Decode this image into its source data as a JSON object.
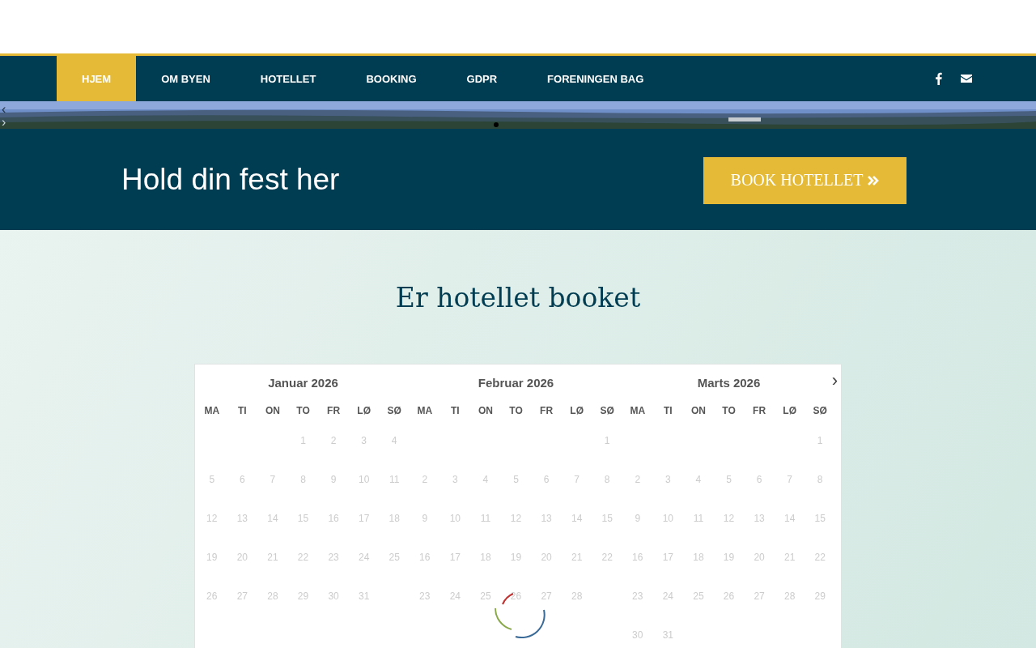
{
  "nav": {
    "items": [
      {
        "label": "HJEM",
        "selected": true
      },
      {
        "label": "OM BYEN",
        "selected": false
      },
      {
        "label": "HOTELLET",
        "selected": false
      },
      {
        "label": "BOOKING",
        "selected": false
      },
      {
        "label": "GDPR",
        "selected": false
      },
      {
        "label": "FORENINGEN BAG",
        "selected": false
      }
    ]
  },
  "slider": {
    "arrows": [
      "‹",
      "›"
    ]
  },
  "hero": {
    "headline": "Hold din fest her",
    "button": "BOOK HOTELLET"
  },
  "section": {
    "title": "Er hotellet booket"
  },
  "calendar": {
    "next": "›",
    "months": [
      {
        "title": "Januar 2026",
        "weekdays": [
          "MA",
          "TI",
          "ON",
          "TO",
          "FR",
          "LØ",
          "SØ"
        ],
        "weeks": [
          [
            {
              "kind": "blank"
            },
            {
              "kind": "blank"
            },
            {
              "kind": "blank"
            },
            {
              "kind": "day",
              "day": "1"
            },
            {
              "kind": "day",
              "day": "2"
            },
            {
              "kind": "day",
              "day": "3"
            },
            {
              "kind": "day",
              "day": "4"
            }
          ],
          [
            {
              "kind": "day",
              "day": "5"
            },
            {
              "kind": "day",
              "day": "6"
            },
            {
              "kind": "day",
              "day": "7"
            },
            {
              "kind": "day",
              "day": "8"
            },
            {
              "kind": "day",
              "day": "9"
            },
            {
              "kind": "day",
              "day": "10"
            },
            {
              "kind": "day",
              "day": "11"
            }
          ],
          [
            {
              "kind": "day",
              "day": "12"
            },
            {
              "kind": "day",
              "day": "13"
            },
            {
              "kind": "day",
              "day": "14"
            },
            {
              "kind": "day",
              "day": "15"
            },
            {
              "kind": "day",
              "day": "16"
            },
            {
              "kind": "day",
              "day": "17"
            },
            {
              "kind": "day",
              "day": "18"
            }
          ],
          [
            {
              "kind": "day",
              "day": "19"
            },
            {
              "kind": "day",
              "day": "20"
            },
            {
              "kind": "day",
              "day": "21"
            },
            {
              "kind": "day",
              "day": "22"
            },
            {
              "kind": "day",
              "day": "23"
            },
            {
              "kind": "day",
              "day": "24"
            },
            {
              "kind": "day",
              "day": "25"
            }
          ],
          [
            {
              "kind": "day",
              "day": "26"
            },
            {
              "kind": "day",
              "day": "27"
            },
            {
              "kind": "day",
              "day": "28"
            },
            {
              "kind": "day",
              "day": "29"
            },
            {
              "kind": "day",
              "day": "30"
            },
            {
              "kind": "day",
              "day": "31"
            },
            {
              "kind": "blank"
            }
          ]
        ]
      },
      {
        "title": "Februar 2026",
        "weekdays": [
          "MA",
          "TI",
          "ON",
          "TO",
          "FR",
          "LØ",
          "SØ"
        ],
        "weeks": [
          [
            {
              "kind": "blank"
            },
            {
              "kind": "blank"
            },
            {
              "kind": "blank"
            },
            {
              "kind": "blank"
            },
            {
              "kind": "blank"
            },
            {
              "kind": "blank"
            },
            {
              "kind": "day",
              "day": "1"
            }
          ],
          [
            {
              "kind": "day",
              "day": "2"
            },
            {
              "kind": "day",
              "day": "3"
            },
            {
              "kind": "day",
              "day": "4"
            },
            {
              "kind": "day",
              "day": "5"
            },
            {
              "kind": "day",
              "day": "6"
            },
            {
              "kind": "day",
              "day": "7"
            },
            {
              "kind": "day",
              "day": "8"
            }
          ],
          [
            {
              "kind": "day",
              "day": "9"
            },
            {
              "kind": "day",
              "day": "10"
            },
            {
              "kind": "day",
              "day": "11"
            },
            {
              "kind": "day",
              "day": "12"
            },
            {
              "kind": "day",
              "day": "13"
            },
            {
              "kind": "day",
              "day": "14"
            },
            {
              "kind": "day",
              "day": "15"
            }
          ],
          [
            {
              "kind": "day",
              "day": "16"
            },
            {
              "kind": "day",
              "day": "17"
            },
            {
              "kind": "day",
              "day": "18"
            },
            {
              "kind": "day",
              "day": "19"
            },
            {
              "kind": "day",
              "day": "20"
            },
            {
              "kind": "day",
              "day": "21"
            },
            {
              "kind": "day",
              "day": "22"
            }
          ],
          [
            {
              "kind": "day",
              "day": "23"
            },
            {
              "kind": "day",
              "day": "24"
            },
            {
              "kind": "day",
              "day": "25"
            },
            {
              "kind": "day",
              "day": "26"
            },
            {
              "kind": "day",
              "day": "27"
            },
            {
              "kind": "day",
              "day": "28"
            },
            {
              "kind": "blank"
            }
          ]
        ]
      },
      {
        "title": "Marts 2026",
        "weekdays": [
          "MA",
          "TI",
          "ON",
          "TO",
          "FR",
          "LØ",
          "SØ"
        ],
        "weeks": [
          [
            {
              "kind": "blank"
            },
            {
              "kind": "blank"
            },
            {
              "kind": "blank"
            },
            {
              "kind": "blank"
            },
            {
              "kind": "blank"
            },
            {
              "kind": "blank"
            },
            {
              "kind": "day",
              "day": "1"
            }
          ],
          [
            {
              "kind": "day",
              "day": "2"
            },
            {
              "kind": "day",
              "day": "3"
            },
            {
              "kind": "day",
              "day": "4"
            },
            {
              "kind": "day",
              "day": "5"
            },
            {
              "kind": "day",
              "day": "6"
            },
            {
              "kind": "day",
              "day": "7"
            },
            {
              "kind": "day",
              "day": "8"
            }
          ],
          [
            {
              "kind": "day",
              "day": "9"
            },
            {
              "kind": "day",
              "day": "10"
            },
            {
              "kind": "day",
              "day": "11"
            },
            {
              "kind": "day",
              "day": "12"
            },
            {
              "kind": "day",
              "day": "13"
            },
            {
              "kind": "day",
              "day": "14"
            },
            {
              "kind": "day",
              "day": "15"
            }
          ],
          [
            {
              "kind": "day",
              "day": "16"
            },
            {
              "kind": "day",
              "day": "17"
            },
            {
              "kind": "day",
              "day": "18"
            },
            {
              "kind": "day",
              "day": "19"
            },
            {
              "kind": "day",
              "day": "20"
            },
            {
              "kind": "day",
              "day": "21"
            },
            {
              "kind": "day",
              "day": "22"
            }
          ],
          [
            {
              "kind": "day",
              "day": "23"
            },
            {
              "kind": "day",
              "day": "24"
            },
            {
              "kind": "day",
              "day": "25"
            },
            {
              "kind": "day",
              "day": "26"
            },
            {
              "kind": "day",
              "day": "27"
            },
            {
              "kind": "day",
              "day": "28"
            },
            {
              "kind": "day",
              "day": "29"
            }
          ],
          [
            {
              "kind": "day",
              "day": "30"
            },
            {
              "kind": "day",
              "day": "31"
            },
            {
              "kind": "blank"
            },
            {
              "kind": "blank"
            },
            {
              "kind": "blank"
            },
            {
              "kind": "blank"
            },
            {
              "kind": "blank"
            }
          ]
        ]
      }
    ]
  }
}
